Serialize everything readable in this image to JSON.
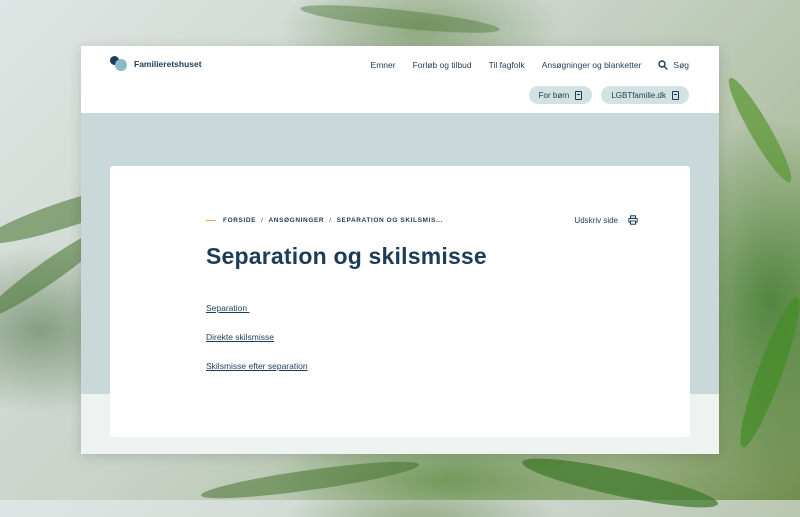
{
  "header": {
    "logo_text": "Familieretshuset",
    "nav": [
      "Emner",
      "Forløb og tilbud",
      "Til fagfolk",
      "Ansøgninger og blanketter"
    ],
    "search_label": "Søg",
    "pills": [
      "For børn",
      "LGBTfamilie.dk"
    ]
  },
  "breadcrumb": [
    "FORSIDE",
    "ANSØGNINGER",
    "SEPARATION OG SKILSMIS..."
  ],
  "print_label": "Udskriv side",
  "page_title": "Separation og skilsmisse",
  "links": [
    "Separation ",
    "Direkte skilsmisse",
    "Skilsmisse efter separation"
  ],
  "colors": {
    "brand_navy": "#1d3c57",
    "pill_bg": "#d2e1e2",
    "band": "#c9d8d8",
    "accent": "#e2a93a"
  },
  "icons": [
    "logo-icon",
    "search-icon",
    "external-link-icon",
    "print-icon"
  ]
}
